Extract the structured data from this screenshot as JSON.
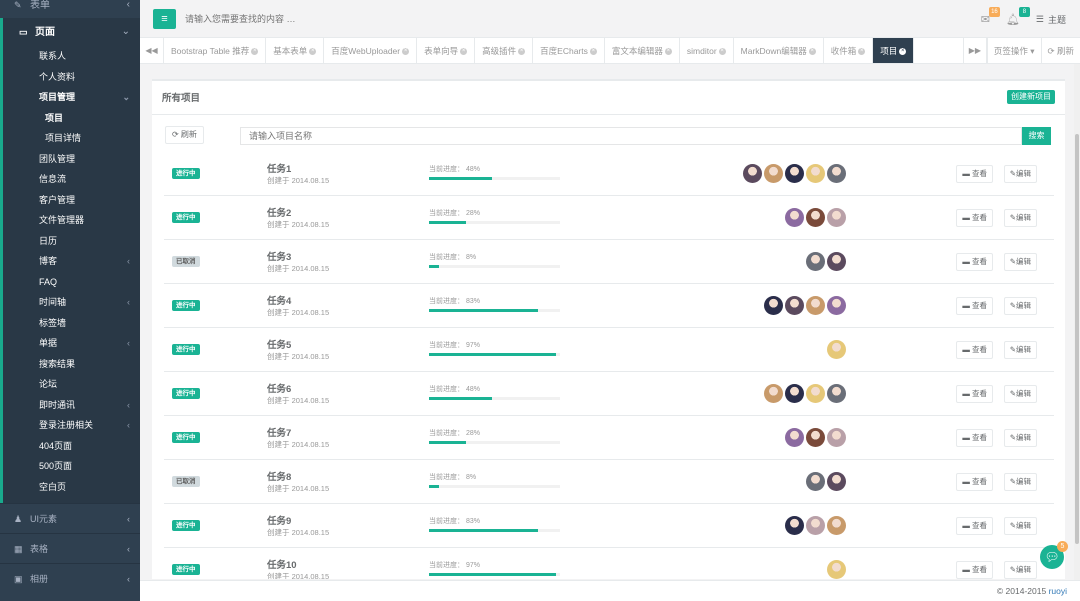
{
  "sidebar": {
    "top_label": "表单",
    "section_label": "页面",
    "items": [
      {
        "label": "联系人",
        "arrow": "",
        "style": "white"
      },
      {
        "label": "个人资料",
        "arrow": "",
        "style": "white"
      },
      {
        "label": "项目管理",
        "arrow": "⌄",
        "style": "bold"
      },
      {
        "label": "项目",
        "arrow": "",
        "style": "sub-bold"
      },
      {
        "label": "项目详情",
        "arrow": "",
        "style": "sub"
      },
      {
        "label": "团队管理",
        "arrow": "",
        "style": "white"
      },
      {
        "label": "信息流",
        "arrow": "",
        "style": "white"
      },
      {
        "label": "客户管理",
        "arrow": "",
        "style": "white"
      },
      {
        "label": "文件管理器",
        "arrow": "",
        "style": "white"
      },
      {
        "label": "日历",
        "arrow": "",
        "style": "white"
      },
      {
        "label": "博客",
        "arrow": "‹",
        "style": "white"
      },
      {
        "label": "FAQ",
        "arrow": "",
        "style": "white"
      },
      {
        "label": "时间轴",
        "arrow": "‹",
        "style": "white"
      },
      {
        "label": "标签墙",
        "arrow": "",
        "style": "white"
      },
      {
        "label": "单据",
        "arrow": "‹",
        "style": "white"
      },
      {
        "label": "搜索结果",
        "arrow": "",
        "style": "white"
      },
      {
        "label": "论坛",
        "arrow": "",
        "style": "white"
      },
      {
        "label": "即时通讯",
        "arrow": "‹",
        "style": "white"
      },
      {
        "label": "登录注册相关",
        "arrow": "‹",
        "style": "white"
      },
      {
        "label": "404页面",
        "arrow": "",
        "style": "white"
      },
      {
        "label": "500页面",
        "arrow": "",
        "style": "white"
      },
      {
        "label": "空白页",
        "arrow": "",
        "style": "white"
      }
    ],
    "bottom": [
      {
        "label": "UI元素",
        "icon": "♟"
      },
      {
        "label": "表格",
        "icon": "▦"
      },
      {
        "label": "相册",
        "icon": "▣"
      }
    ]
  },
  "topbar": {
    "search_placeholder": "请输入您需要查找的内容 …",
    "mail_count": "16",
    "bell_count": "8",
    "theme_label": "主题"
  },
  "tabs": {
    "items": [
      {
        "label": "Bootstrap Table 推荐",
        "active": false
      },
      {
        "label": "基本表单",
        "active": false
      },
      {
        "label": "百度WebUploader",
        "active": false
      },
      {
        "label": "表单向导",
        "active": false
      },
      {
        "label": "高级插件",
        "active": false
      },
      {
        "label": "百度ECharts",
        "active": false
      },
      {
        "label": "富文本编辑器",
        "active": false
      },
      {
        "label": "simditor",
        "active": false
      },
      {
        "label": "MarkDown编辑器",
        "active": false
      },
      {
        "label": "收件箱",
        "active": false
      },
      {
        "label": "项目",
        "active": true
      }
    ],
    "ops_label": "页签操作 ▾",
    "refresh_label": "⟳ 刷新"
  },
  "panel": {
    "title": "所有项目",
    "create_button": "创建新项目",
    "refresh_button": "⟳ 刷新",
    "search_placeholder": "请输入项目名称",
    "search_button": "搜索"
  },
  "progress_prefix": "当前进度：",
  "view_label": "查看",
  "edit_label": "编辑",
  "avatar_colors": [
    "#5b4a5e",
    "#c89a6a",
    "#2a2d4a",
    "#e6c878",
    "#6a6e78",
    "#8b6aa0",
    "#7a4a3a",
    "#b9a0a8"
  ],
  "projects": [
    {
      "status": "进行中",
      "status_type": "on",
      "name": "任务1",
      "date": "创建于 2014.08.15",
      "progress": "48%",
      "percent": 48,
      "avatars": [
        0,
        1,
        2,
        3,
        4
      ]
    },
    {
      "status": "进行中",
      "status_type": "on",
      "name": "任务2",
      "date": "创建于 2014.08.15",
      "progress": "28%",
      "percent": 28,
      "avatars": [
        5,
        6,
        7
      ]
    },
    {
      "status": "已取消",
      "status_type": "off",
      "name": "任务3",
      "date": "创建于 2014.08.15",
      "progress": "8%",
      "percent": 8,
      "avatars": [
        4,
        0
      ]
    },
    {
      "status": "进行中",
      "status_type": "on",
      "name": "任务4",
      "date": "创建于 2014.08.15",
      "progress": "83%",
      "percent": 83,
      "avatars": [
        2,
        0,
        1,
        5
      ]
    },
    {
      "status": "进行中",
      "status_type": "on",
      "name": "任务5",
      "date": "创建于 2014.08.15",
      "progress": "97%",
      "percent": 97,
      "avatars": [
        3
      ]
    },
    {
      "status": "进行中",
      "status_type": "on",
      "name": "任务6",
      "date": "创建于 2014.08.15",
      "progress": "48%",
      "percent": 48,
      "avatars": [
        1,
        2,
        3,
        4
      ]
    },
    {
      "status": "进行中",
      "status_type": "on",
      "name": "任务7",
      "date": "创建于 2014.08.15",
      "progress": "28%",
      "percent": 28,
      "avatars": [
        5,
        6,
        7
      ]
    },
    {
      "status": "已取消",
      "status_type": "off",
      "name": "任务8",
      "date": "创建于 2014.08.15",
      "progress": "8%",
      "percent": 8,
      "avatars": [
        4,
        0
      ]
    },
    {
      "status": "进行中",
      "status_type": "on",
      "name": "任务9",
      "date": "创建于 2014.08.15",
      "progress": "83%",
      "percent": 83,
      "avatars": [
        2,
        7,
        1
      ]
    },
    {
      "status": "进行中",
      "status_type": "on",
      "name": "任务10",
      "date": "创建于 2014.08.15",
      "progress": "97%",
      "percent": 97,
      "avatars": [
        3
      ]
    }
  ],
  "footer": {
    "text": "© 2014-2015 ",
    "link": "ruoyi"
  },
  "chat_badge": "5"
}
